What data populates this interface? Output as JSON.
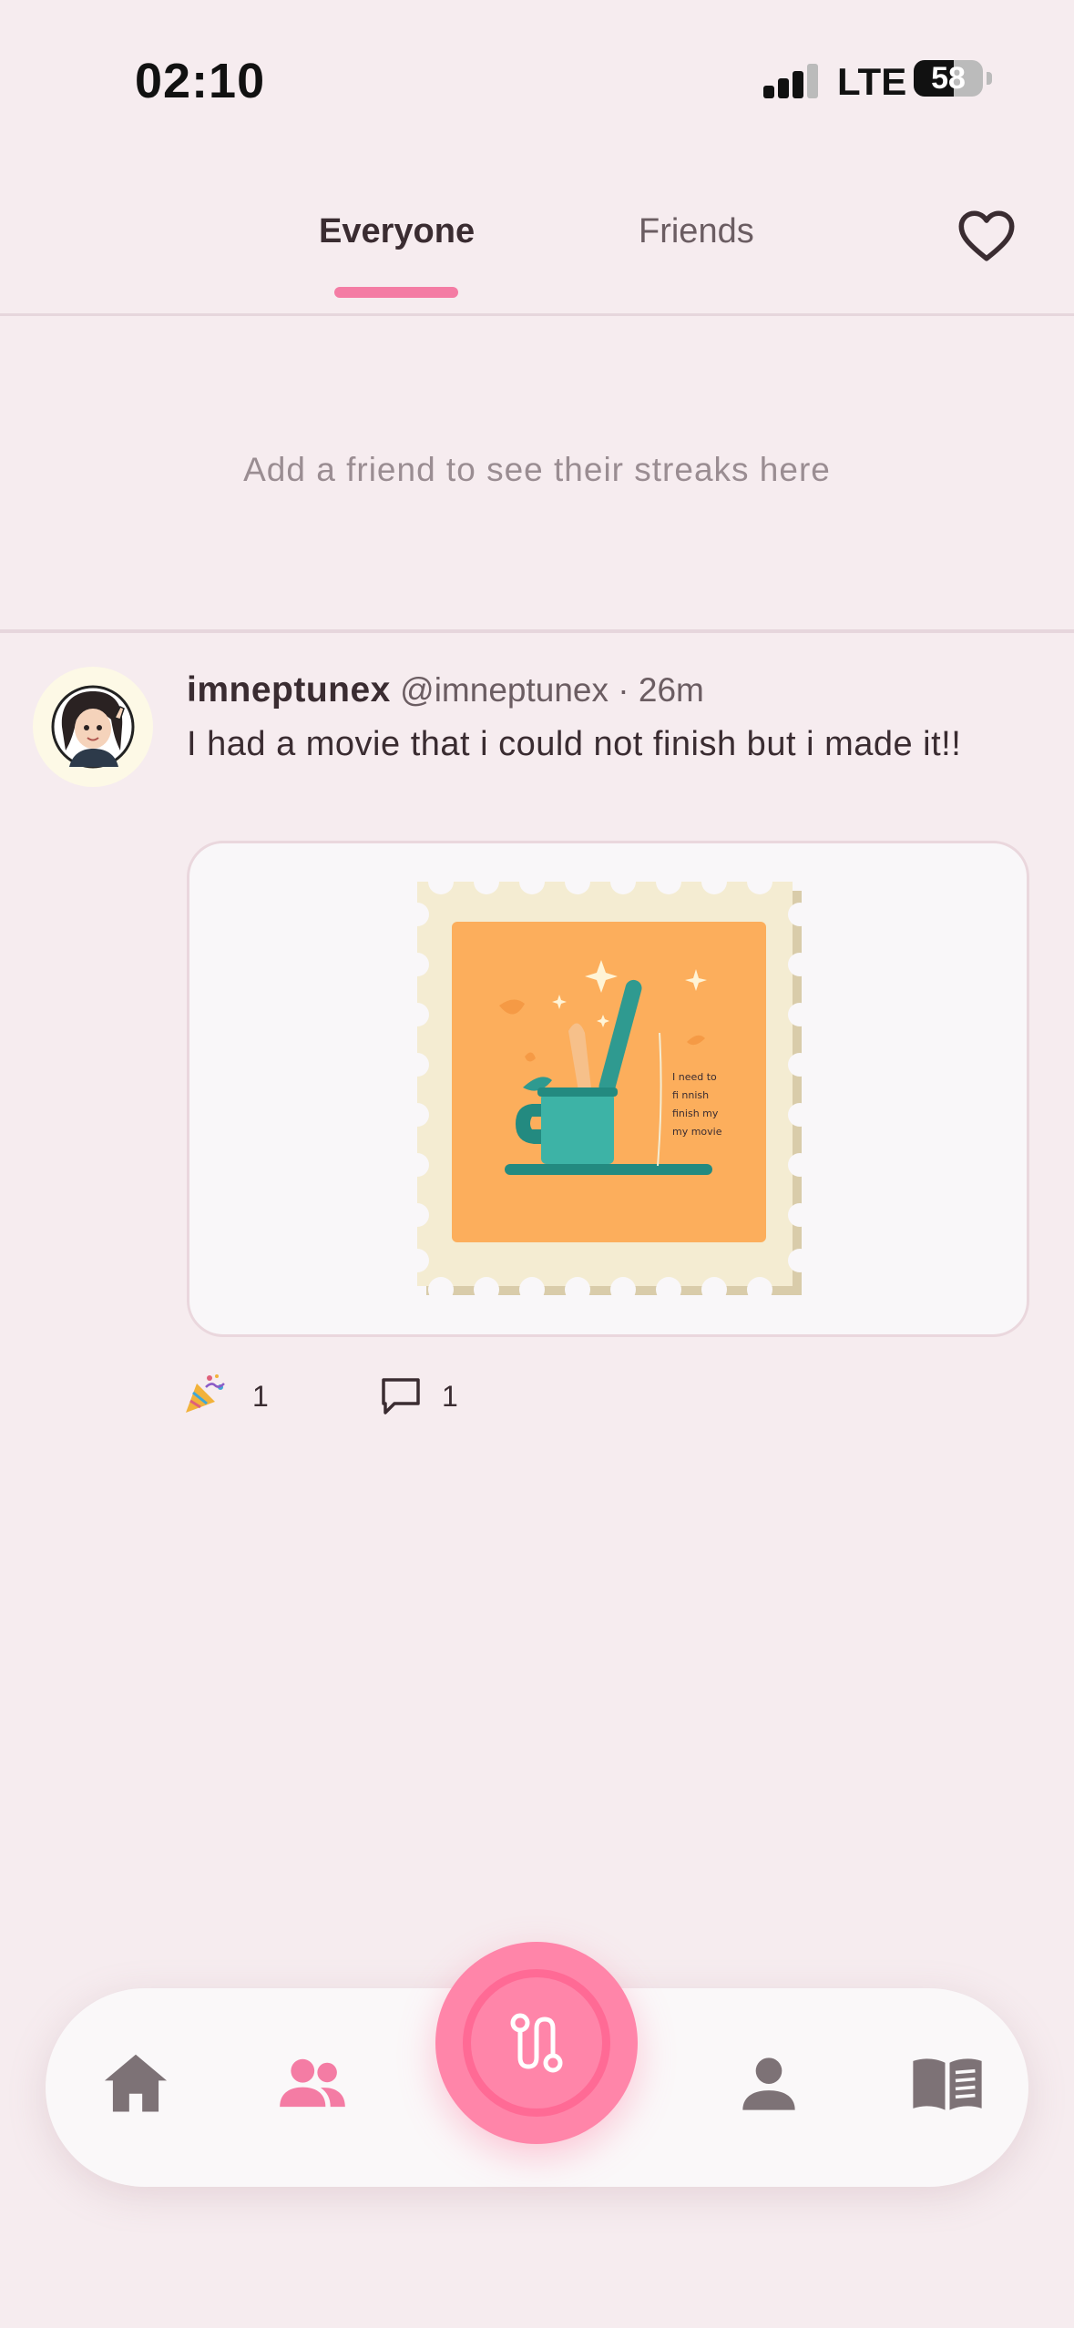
{
  "status_bar": {
    "time": "02:10",
    "network": "LTE",
    "battery": "58",
    "battery_fraction": 0.58
  },
  "tabs": {
    "items": [
      {
        "label": "Everyone",
        "active": true
      },
      {
        "label": "Friends",
        "active": false
      }
    ],
    "accent_color": "#f47ca4",
    "heart_icon": "heart-outline-icon"
  },
  "streaks": {
    "empty_text": "Add a friend to see their streaks here"
  },
  "post": {
    "username": "imneptunex",
    "handle": "@imneptunex",
    "separator": "·",
    "time": "26m",
    "text": "I had a movie that i could not finish but i made it!!",
    "image_caption_lines": [
      "I need to",
      "fi nnish",
      "finish my",
      "my movie"
    ],
    "reaction_icon": "party-popper-icon",
    "reaction_count": "1",
    "comment_icon": "comment-bubble-icon",
    "comment_count": "1"
  },
  "bottom_nav": {
    "items": [
      {
        "icon": "home-icon",
        "active": false
      },
      {
        "icon": "friends-icon",
        "active": true
      },
      {
        "icon": "profile-icon",
        "active": false
      },
      {
        "icon": "journal-book-icon",
        "active": false
      }
    ],
    "fab_icon": "route-path-icon",
    "active_color": "#f47ca4",
    "inactive_color": "#7d7276"
  }
}
